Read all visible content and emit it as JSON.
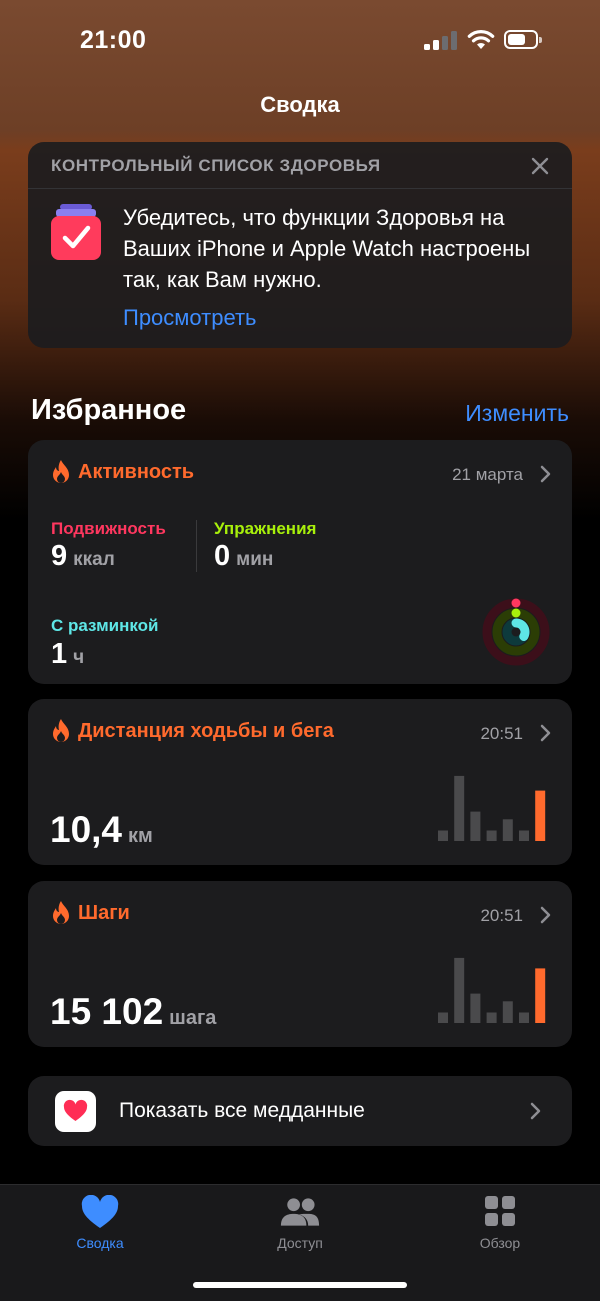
{
  "status_bar": {
    "time": "21:00"
  },
  "nav": {
    "title": "Сводка"
  },
  "health_checklist": {
    "header": "КОНТРОЛЬНЫЙ СПИСОК ЗДОРОВЬЯ",
    "body": "Убедитесь, что функции Здоровья на Ваших iPhone и Apple Watch настроены так, как Вам нужно.",
    "link": "Просмотреть"
  },
  "favorites": {
    "title": "Избранное",
    "edit": "Изменить"
  },
  "activity": {
    "title": "Активность",
    "date": "21 марта",
    "move": {
      "label": "Подвижность",
      "value": "9",
      "unit": "ккал",
      "color": "#ff375f"
    },
    "exercise": {
      "label": "Упражнения",
      "value": "0",
      "unit": "мин",
      "color": "#a8f00b"
    },
    "stand": {
      "label": "С разминкой",
      "value": "1",
      "unit": "ч",
      "color": "#5ee6e6"
    }
  },
  "walking_distance": {
    "title": "Дистанция ходьбы и бега",
    "time": "20:51",
    "value": "10,4",
    "unit": "км",
    "bars": [
      0.15,
      0.93,
      0.42,
      0.15,
      0.31,
      0.15,
      0.72
    ]
  },
  "steps": {
    "title": "Шаги",
    "time": "20:51",
    "value": "15 102",
    "unit": "шага",
    "bars": [
      0.15,
      0.93,
      0.42,
      0.15,
      0.31,
      0.15,
      0.78
    ]
  },
  "all_health_data": {
    "label": "Показать все медданные"
  },
  "tabs": [
    {
      "label": "Сводка",
      "icon": "heart-icon",
      "active": true
    },
    {
      "label": "Доступ",
      "icon": "people-icon",
      "active": false
    },
    {
      "label": "Обзор",
      "icon": "grid-icon",
      "active": false
    }
  ],
  "colors": {
    "accent": "#3e8dff",
    "activity_orange": "#ff6a2d",
    "card": "#1c1c1e"
  }
}
